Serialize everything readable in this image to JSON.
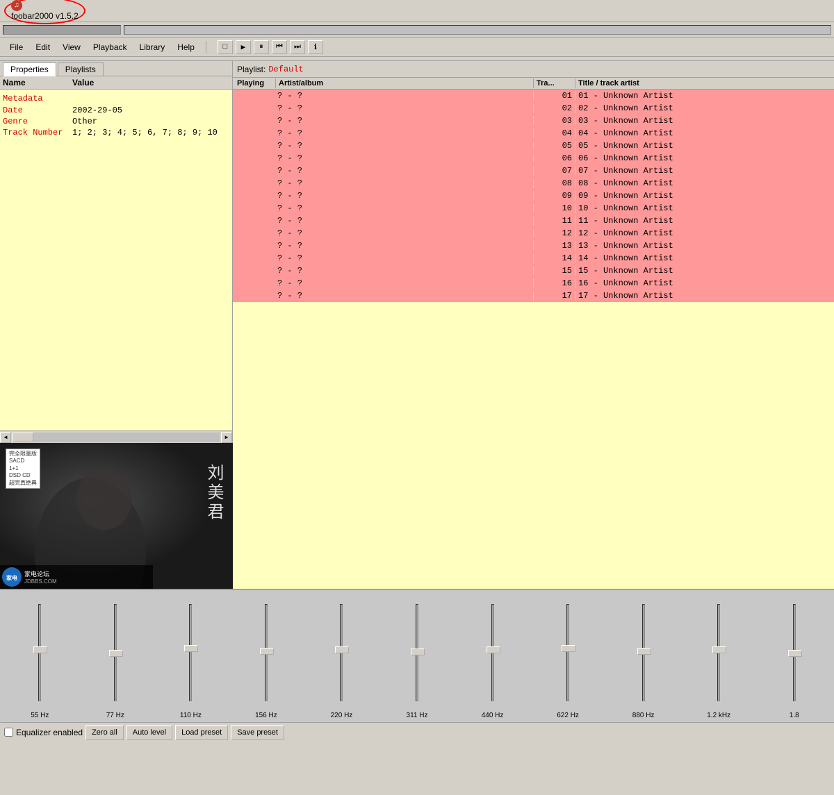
{
  "titleBar": {
    "title": "foobar2000 v1.5.2",
    "iconLabel": "fb"
  },
  "menuBar": {
    "items": [
      "File",
      "Edit",
      "View",
      "Playback",
      "Library",
      "Help"
    ],
    "transport": {
      "stop": "□",
      "play": "▶",
      "pause": "⏸",
      "prev": "⏮",
      "next": "⏭",
      "info": "ℹ"
    }
  },
  "leftPanel": {
    "tabs": [
      "Properties",
      "Playlists"
    ],
    "activeTab": 0,
    "tableHeaders": {
      "name": "Name",
      "value": "Value"
    },
    "properties": [
      {
        "type": "section",
        "name": "Metadata",
        "value": ""
      },
      {
        "type": "row",
        "name": "Date",
        "value": "2002-29-05"
      },
      {
        "type": "row",
        "name": "Genre",
        "value": "Other"
      },
      {
        "type": "row",
        "name": "Track Number",
        "value": "1; 2; 3; 4; 5; 6, 7; 8; 9; 10"
      }
    ]
  },
  "playlist": {
    "label": "Playlist:",
    "name": "Default",
    "columns": [
      "Playing",
      "Artist/album",
      "Tra...",
      "Title / track artist"
    ],
    "rows": [
      {
        "playing": "",
        "artist": "? - ?",
        "track": "01",
        "title": "01 - Unknown Artist"
      },
      {
        "playing": "",
        "artist": "? - ?",
        "track": "02",
        "title": "02 - Unknown Artist"
      },
      {
        "playing": "",
        "artist": "? - ?",
        "track": "03",
        "title": "03 - Unknown Artist"
      },
      {
        "playing": "",
        "artist": "? - ?",
        "track": "04",
        "title": "04 - Unknown Artist"
      },
      {
        "playing": "",
        "artist": "? - ?",
        "track": "05",
        "title": "05 - Unknown Artist"
      },
      {
        "playing": "",
        "artist": "? - ?",
        "track": "06",
        "title": "06 - Unknown Artist"
      },
      {
        "playing": "",
        "artist": "? - ?",
        "track": "07",
        "title": "07 - Unknown Artist"
      },
      {
        "playing": "",
        "artist": "? - ?",
        "track": "08",
        "title": "08 - Unknown Artist"
      },
      {
        "playing": "",
        "artist": "? - ?",
        "track": "09",
        "title": "09 - Unknown Artist"
      },
      {
        "playing": "",
        "artist": "? - ?",
        "track": "10",
        "title": "10 - Unknown Artist"
      },
      {
        "playing": "",
        "artist": "? - ?",
        "track": "11",
        "title": "11 - Unknown Artist"
      },
      {
        "playing": "",
        "artist": "? - ?",
        "track": "12",
        "title": "12 - Unknown Artist"
      },
      {
        "playing": "",
        "artist": "? - ?",
        "track": "13",
        "title": "13 - Unknown Artist"
      },
      {
        "playing": "",
        "artist": "? - ?",
        "track": "14",
        "title": "14 - Unknown Artist"
      },
      {
        "playing": "",
        "artist": "? - ?",
        "track": "15",
        "title": "15 - Unknown Artist"
      },
      {
        "playing": "",
        "artist": "? - ?",
        "track": "16",
        "title": "16 - Unknown Artist"
      },
      {
        "playing": "",
        "artist": "? - ?",
        "track": "17",
        "title": "17 - Unknown Artist"
      }
    ]
  },
  "albumArt": {
    "artistName": "刘美君",
    "labelLines": [
      "完全限量版",
      "SACD",
      "1+1",
      "DSD CD",
      "超完真绝典"
    ],
    "bottomText": "家电论坛",
    "bottomSite": "JDBBS.COM"
  },
  "equalizer": {
    "bands": [
      {
        "freq": "55 Hz",
        "thumbPos": 60
      },
      {
        "freq": "77 Hz",
        "thumbPos": 65
      },
      {
        "freq": "110 Hz",
        "thumbPos": 58
      },
      {
        "freq": "156 Hz",
        "thumbPos": 62
      },
      {
        "freq": "220 Hz",
        "thumbPos": 60
      },
      {
        "freq": "311 Hz",
        "thumbPos": 63
      },
      {
        "freq": "440 Hz",
        "thumbPos": 60
      },
      {
        "freq": "622 Hz",
        "thumbPos": 58
      },
      {
        "freq": "880 Hz",
        "thumbPos": 62
      },
      {
        "freq": "1.2 kHz",
        "thumbPos": 60
      },
      {
        "freq": "1.8",
        "thumbPos": 65
      }
    ],
    "controls": {
      "checkboxLabel": "Equalizer enabled",
      "buttons": [
        "Zero all",
        "Auto level",
        "Load preset",
        "Save preset"
      ]
    }
  }
}
